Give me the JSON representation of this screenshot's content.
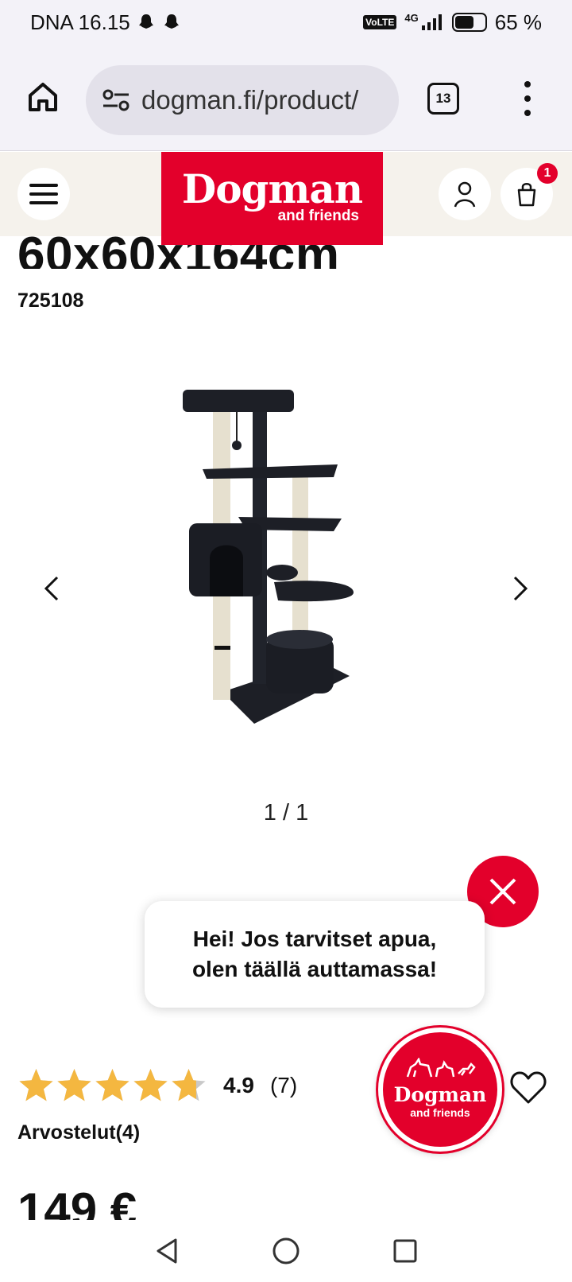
{
  "status_bar": {
    "carrier_time": "DNA 16.15",
    "volte": "VoLTE",
    "network": "4G",
    "battery_level": 0.65,
    "battery": "65 %"
  },
  "browser": {
    "url": "dogman.fi/product/",
    "tab_count": "13"
  },
  "site_header": {
    "logo_main": "Dogman",
    "logo_sub": "and friends",
    "cart_count": "1"
  },
  "product": {
    "title": "60x60x164cm",
    "sku": "725108",
    "gallery_counter": "1 / 1",
    "rating_value": 4.9,
    "rating_score": "4.9",
    "rating_count": "(7)",
    "reviews_link": "Arvostelut(4)",
    "price": "149 €"
  },
  "chat": {
    "message_line1": "Hei! Jos tarvitset apua,",
    "message_line2": "olen täällä auttamassa!",
    "launcher_main": "Dogman",
    "launcher_sub": "and friends"
  },
  "colors": {
    "brand_red": "#e3002b",
    "star_gold": "#f4b740",
    "header_bg": "#f5f2ec",
    "browser_bg": "#f3f2f8"
  },
  "icons": [
    "ghost-icon",
    "signal-icon",
    "battery-icon",
    "home-icon",
    "site-settings-icon",
    "tabs-icon",
    "more-icon",
    "hamburger-icon",
    "user-icon",
    "bag-icon",
    "chevron-left-icon",
    "chevron-right-icon",
    "close-icon",
    "star-icon",
    "heart-icon",
    "back-icon",
    "home-circle-icon",
    "recents-icon"
  ]
}
